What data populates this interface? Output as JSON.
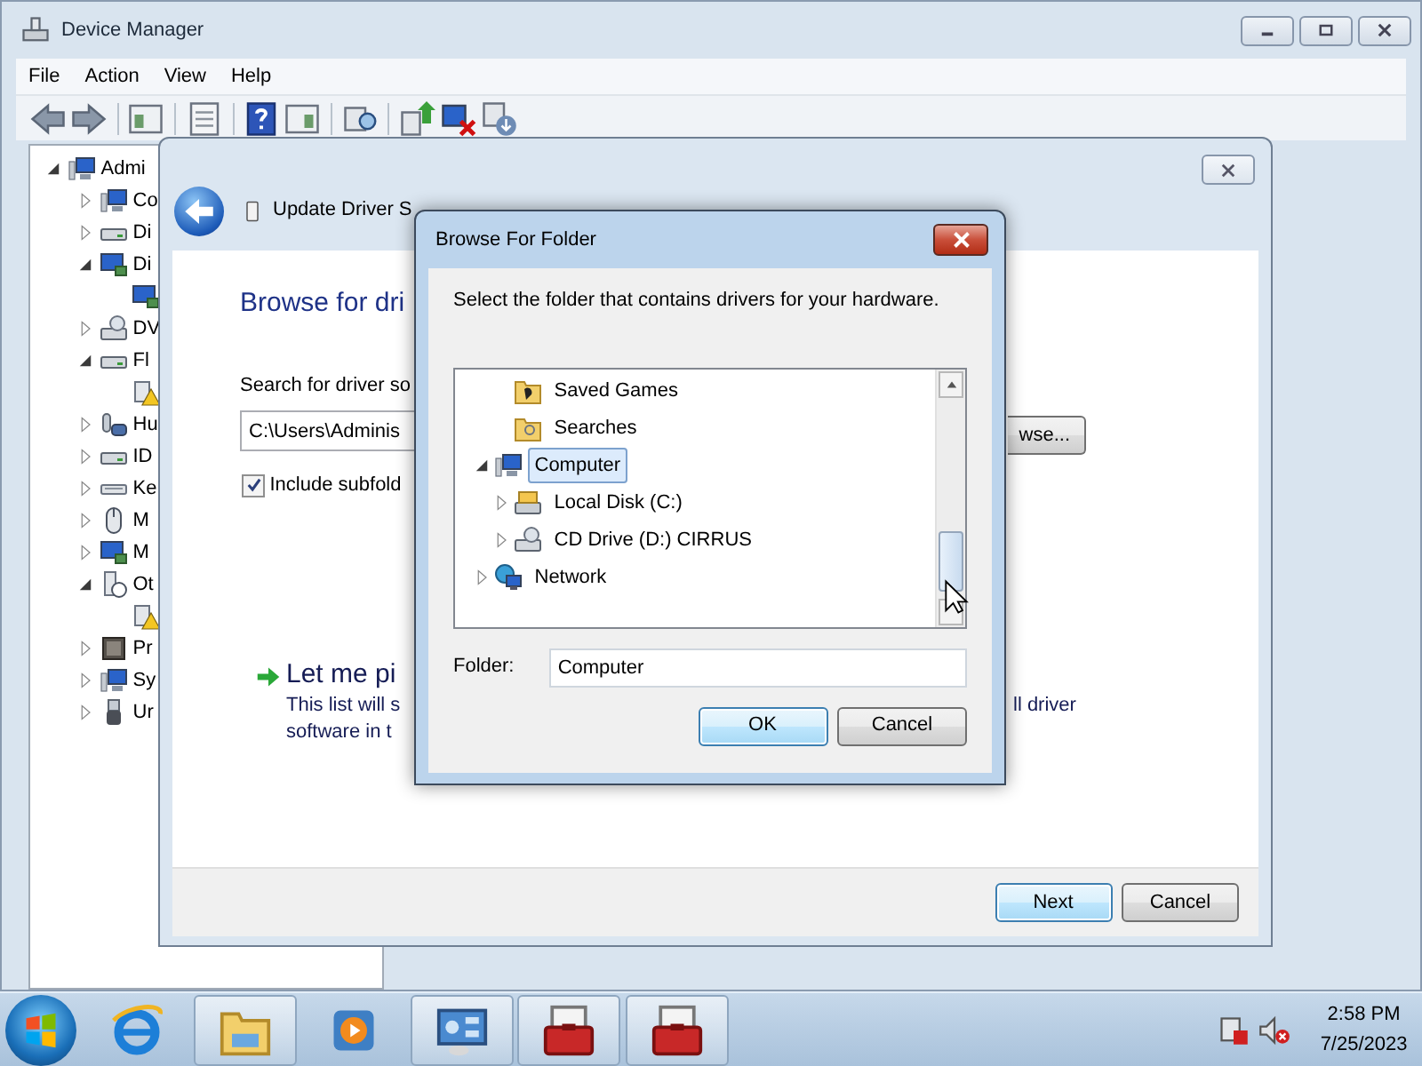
{
  "device_manager": {
    "title": "Device Manager",
    "menu": [
      "File",
      "Action",
      "View",
      "Help"
    ],
    "tree": [
      {
        "label": "Admi",
        "kind": "computer",
        "expanded": true,
        "children": [
          {
            "label": "Co",
            "kind": "computer",
            "expanded": false
          },
          {
            "label": "Di",
            "kind": "drive",
            "expanded": false
          },
          {
            "label": "Di",
            "kind": "display",
            "expanded": true,
            "children": [
              {
                "kind": "display"
              }
            ]
          },
          {
            "label": "DV",
            "kind": "dvd",
            "expanded": false
          },
          {
            "label": "Fl",
            "kind": "drive",
            "expanded": true,
            "children": [
              {
                "kind": "warning"
              }
            ]
          },
          {
            "label": "Hu",
            "kind": "hid",
            "expanded": false
          },
          {
            "label": "ID",
            "kind": "drive",
            "expanded": false
          },
          {
            "label": "Ke",
            "kind": "keyboard",
            "expanded": false
          },
          {
            "label": "M",
            "kind": "mouse",
            "expanded": false
          },
          {
            "label": "M",
            "kind": "display",
            "expanded": false
          },
          {
            "label": "Ot",
            "kind": "other",
            "expanded": true,
            "children": [
              {
                "kind": "warning"
              }
            ]
          },
          {
            "label": "Pr",
            "kind": "chip",
            "expanded": false
          },
          {
            "label": "Sy",
            "kind": "computer",
            "expanded": false
          },
          {
            "label": "Ur",
            "kind": "usb",
            "expanded": false
          }
        ]
      }
    ]
  },
  "wizard": {
    "title": "Update Driver S",
    "heading": "Browse for dri",
    "search_label": "Search for driver so",
    "path": "C:\\Users\\Adminis",
    "browse_button": "wse...",
    "include_subfolders": {
      "label": "Include subfold",
      "checked": true
    },
    "pick_title": "Let me pi",
    "pick_desc_lines": [
      "This list will s",
      "software in t"
    ],
    "pick_desc_right": "ll driver",
    "buttons": [
      {
        "label": "Next",
        "default": true
      },
      {
        "label": "Cancel",
        "default": false
      }
    ]
  },
  "browse_dialog": {
    "title": "Browse For Folder",
    "instruction": "Select the folder that contains drivers for your hardware.",
    "tree": [
      {
        "children": [
          {
            "label": "Saved Games",
            "kind": "saved-games",
            "selected": false
          },
          {
            "label": "Searches",
            "kind": "searches",
            "selected": false
          }
        ]
      },
      {
        "label": "Computer",
        "kind": "computer",
        "expanded": true,
        "selected": true,
        "children": [
          {
            "label": "Local Disk (C:)",
            "kind": "disk",
            "expanded": false,
            "selected": false
          },
          {
            "label": "CD Drive (D:) CIRRUS",
            "kind": "dvd",
            "expanded": false,
            "selected": false
          }
        ]
      },
      {
        "label": "Network",
        "kind": "network",
        "expanded": false,
        "selected": false
      }
    ],
    "folder_label": "Folder:",
    "folder_value": "Computer",
    "buttons": [
      {
        "label": "OK",
        "default": true
      },
      {
        "label": "Cancel",
        "default": false
      }
    ]
  },
  "taskbar": {
    "buttons": [
      {
        "kind": "ie",
        "running": false
      },
      {
        "kind": "explorer",
        "running": true
      },
      {
        "kind": "media",
        "running": false
      },
      {
        "kind": "devices",
        "running": true
      },
      {
        "kind": "toolbox",
        "running": true
      },
      {
        "kind": "toolbox",
        "running": true
      }
    ],
    "time": "2:58 PM",
    "date": "7/25/2023"
  }
}
